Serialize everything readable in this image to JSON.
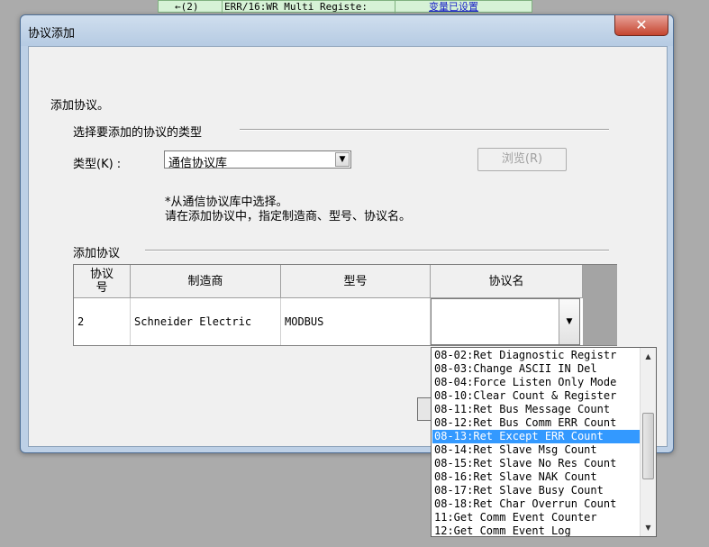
{
  "background": {
    "cell1": "←(2)",
    "cell2": "ERR/16:WR Multi Registe:",
    "cell3": "变量已设置"
  },
  "dialog": {
    "title": "协议添加",
    "close_glyph": "✕",
    "intro": "添加协议。",
    "section_select": "选择要添加的协议的类型",
    "type_label": "类型(K)  :",
    "type_value": "通信协议库",
    "browse_label": "浏览(R)",
    "note_line1": "*从通信协议库中选择。",
    "note_line2": "请在添加协议中，指定制造商、型号、协议名。",
    "section_add": "添加协议"
  },
  "table": {
    "headers": [
      "协议\n号",
      "制造商",
      "型号",
      "协议名"
    ],
    "row": {
      "number": "2",
      "maker": "Schneider Electric",
      "model": "MODBUS",
      "protocol": ""
    }
  },
  "dropdown": {
    "selected_index": 6,
    "items": [
      "08-02:Ret Diagnostic Registr",
      "08-03:Change ASCII IN Del",
      "08-04:Force Listen Only Mode",
      "08-10:Clear Count & Register",
      "08-11:Ret Bus Message Count",
      "08-12:Ret Bus Comm ERR Count",
      "08-13:Ret Except ERR Count",
      "08-14:Ret Slave Msg Count",
      "08-15:Ret Slave No Res Count",
      "08-16:Ret Slave NAK Count",
      "08-17:Ret Slave Busy Count",
      "08-18:Ret Char Overrun Count",
      "11:Get Comm Event Counter",
      "12:Get Comm Event Log"
    ]
  },
  "colors": {
    "selection": "#3399ff",
    "window_frame": "#bdd0e6",
    "close_button": "#c5452f"
  }
}
